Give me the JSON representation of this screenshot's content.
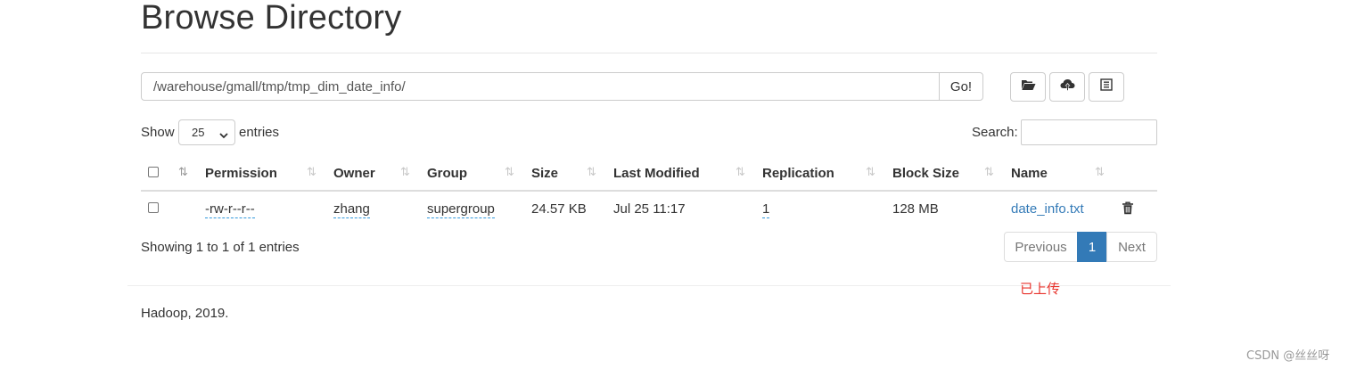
{
  "header": {
    "title": "Browse Directory"
  },
  "path_bar": {
    "path": "/warehouse/gmall/tmp/tmp_dim_date_info/",
    "go_label": "Go!"
  },
  "toolbar": [
    {
      "icon": "folder-open-icon",
      "label": ""
    },
    {
      "icon": "upload-icon",
      "label": ""
    },
    {
      "icon": "list-icon",
      "label": ""
    }
  ],
  "controls": {
    "show_label": "Show",
    "page_size": "25",
    "entries_label": "entries",
    "search_label": "Search:",
    "search_value": ""
  },
  "table": {
    "columns": [
      "Permission",
      "Owner",
      "Group",
      "Size",
      "Last Modified",
      "Replication",
      "Block Size",
      "Name"
    ],
    "rows": [
      {
        "permission": "-rw-r--r--",
        "owner": "zhang",
        "group": "supergroup",
        "size": "24.57 KB",
        "last_modified": "Jul 25 11:17",
        "replication": "1",
        "block_size": "128 MB",
        "name": "date_info.txt"
      }
    ]
  },
  "pagination": {
    "summary": "Showing 1 to 1 of 1 entries",
    "previous_label": "Previous",
    "current_page": "1",
    "next_label": "Next"
  },
  "annotation": {
    "text": "已上传",
    "color": "#e8332c"
  },
  "footer": {
    "text": "Hadoop, 2019."
  },
  "watermark": {
    "text": "CSDN @丝丝呀"
  },
  "colors": {
    "accent": "#337ab7",
    "border": "#cccccc"
  }
}
